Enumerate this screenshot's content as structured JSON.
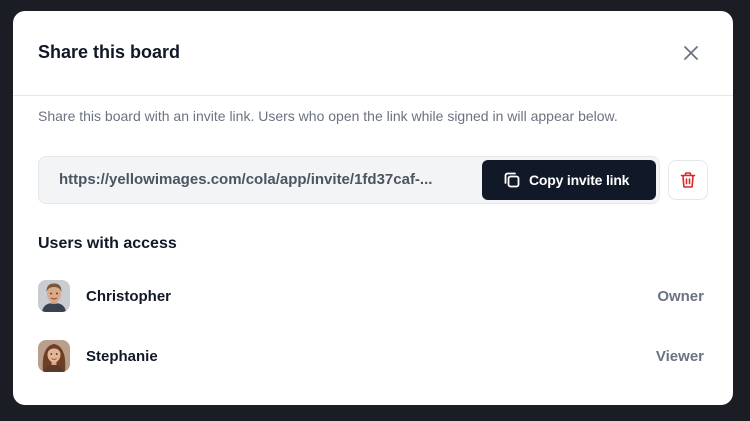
{
  "modal": {
    "title": "Share this board",
    "description": "Share this board with an invite link. Users who open the link while signed in will appear below."
  },
  "invite": {
    "link_text": "https://yellowimages.com/cola/app/invite/1fd37caf-...",
    "copy_label": "Copy invite link"
  },
  "access": {
    "section_title": "Users with access",
    "users": [
      {
        "name": "Christopher",
        "role": "Owner"
      },
      {
        "name": "Stephanie",
        "role": "Viewer"
      }
    ]
  },
  "icons": {
    "close": "close-icon",
    "copy": "copy-icon",
    "delete": "trash-icon"
  },
  "colors": {
    "backdrop": "#1a1d24",
    "primary_button": "#111827",
    "danger": "#dc2626"
  }
}
